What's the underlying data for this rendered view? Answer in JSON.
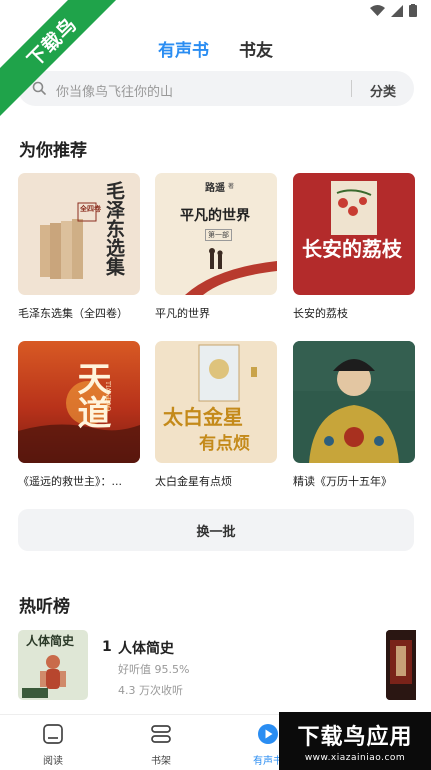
{
  "watermark": {
    "corner_text": "下载鸟",
    "bottom_brand": "下载鸟应用",
    "bottom_url": "www.xiazainiao.com"
  },
  "tabs": [
    {
      "label": "有声书",
      "active": true
    },
    {
      "label": "书友",
      "active": false
    }
  ],
  "search": {
    "placeholder": "你当像鸟飞往你的山",
    "category_label": "分类"
  },
  "recommend": {
    "title": "为你推荐",
    "books": [
      {
        "title": "毛泽东选集（全四卷）",
        "cover_text": "毛泽东选集",
        "cover_badge": "全四卷"
      },
      {
        "title": "平凡的世界",
        "cover_text": "平凡的世界",
        "cover_author": "路遥",
        "cover_author_suffix": "著",
        "cover_volume": "第一部"
      },
      {
        "title": "长安的荔枝",
        "cover_text": "长安的荔枝"
      },
      {
        "title": "《遥远的救世主》：...",
        "cover_text": "天道",
        "cover_sub": "TIANDAO"
      },
      {
        "title": "太白金星有点烦",
        "cover_text_top": "太白金星",
        "cover_text_bottom": "有点烦"
      },
      {
        "title": "精读《万历十五年》"
      }
    ],
    "refresh_label": "换一批"
  },
  "hot": {
    "title": "热听榜",
    "items": [
      {
        "rank": "1",
        "title": "人体简史",
        "cover_text": "人体简史",
        "rating": "好听值 95.5%",
        "plays": "4.3 万次收听"
      }
    ]
  },
  "nav": [
    {
      "label": "阅读",
      "icon": "read-icon",
      "active": false
    },
    {
      "label": "书架",
      "icon": "bookshelf-icon",
      "active": false
    },
    {
      "label": "有声书",
      "icon": "play-circle-icon",
      "active": true
    }
  ],
  "colors": {
    "accent": "#2a8df2",
    "watermark_green": "#1fa34a"
  }
}
